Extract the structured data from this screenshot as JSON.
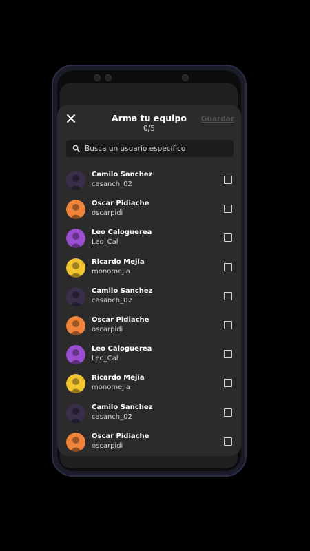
{
  "sheet": {
    "title": "Arma tu equipo",
    "counter": "0/5",
    "save_label": "Guardar"
  },
  "search": {
    "placeholder": "Busca un usuario específico"
  },
  "users": [
    {
      "name": "Camilo Sanchez",
      "username": "casanch_02",
      "avatar": "purple-dark"
    },
    {
      "name": "Oscar Pidiache",
      "username": "oscarpidi",
      "avatar": "orange"
    },
    {
      "name": "Leo Caloguerea",
      "username": "Leo_Cal",
      "avatar": "purple"
    },
    {
      "name": "Ricardo Mejia",
      "username": "monomejia",
      "avatar": "yellow"
    },
    {
      "name": "Camilo Sanchez",
      "username": "casanch_02",
      "avatar": "purple-dark"
    },
    {
      "name": "Oscar Pidiache",
      "username": "oscarpidi",
      "avatar": "orange"
    },
    {
      "name": "Leo Caloguerea",
      "username": "Leo_Cal",
      "avatar": "purple"
    },
    {
      "name": "Ricardo Mejia",
      "username": "monomejia",
      "avatar": "yellow"
    },
    {
      "name": "Camilo Sanchez",
      "username": "casanch_02",
      "avatar": "purple-dark"
    },
    {
      "name": "Oscar Pidiache",
      "username": "oscarpidi",
      "avatar": "orange"
    }
  ],
  "colors": {
    "purple-dark": "#3a2f4a",
    "orange": "#f0843a",
    "purple": "#9a4fd1",
    "yellow": "#f4c430"
  }
}
